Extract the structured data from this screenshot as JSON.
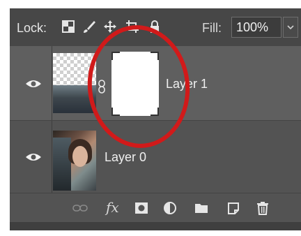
{
  "toolbar": {
    "lock_label": "Lock:",
    "fill_label": "Fill:",
    "fill_value": "100%"
  },
  "layers": [
    {
      "name": "Layer 1"
    },
    {
      "name": "Layer 0"
    }
  ],
  "colors": {
    "panel_bg": "#535353",
    "selected_row_bg": "#5f5f5f",
    "annotation": "#d11a1a"
  },
  "icons": {
    "toolbar": [
      "lock-transparent-pixels-icon",
      "lock-image-pixels-icon",
      "lock-position-icon",
      "lock-artboard-icon",
      "lock-all-icon"
    ],
    "bottom": [
      "link-layers-icon",
      "fx-icon",
      "add-mask-icon",
      "adjustment-layer-icon",
      "new-group-icon",
      "new-layer-icon",
      "delete-layer-icon"
    ]
  }
}
